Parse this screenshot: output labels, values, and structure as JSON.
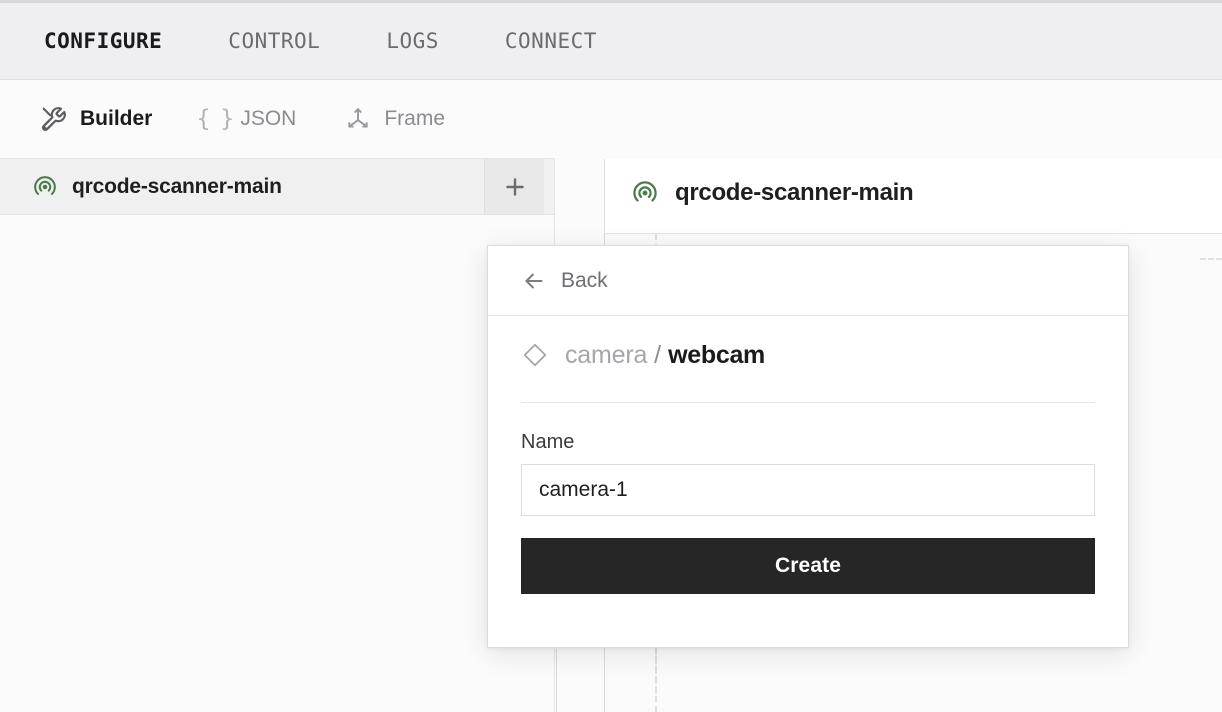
{
  "topnav": {
    "items": [
      {
        "label": "CONFIGURE",
        "active": true
      },
      {
        "label": "CONTROL",
        "active": false
      },
      {
        "label": "LOGS",
        "active": false
      },
      {
        "label": "CONNECT",
        "active": false
      }
    ]
  },
  "subtabs": {
    "items": [
      {
        "label": "Builder",
        "icon": "tools-icon",
        "active": true
      },
      {
        "label": "JSON",
        "icon": "braces-icon",
        "active": false
      },
      {
        "label": "Frame",
        "icon": "axes-icon",
        "active": false
      }
    ]
  },
  "sidebar": {
    "selected_item": {
      "label": "qrcode-scanner-main",
      "icon": "broadcast-icon"
    },
    "add_button": {
      "label": "+",
      "icon": "plus-icon"
    }
  },
  "canvas": {
    "node_card": {
      "label": "qrcode-scanner-main",
      "icon": "broadcast-icon"
    }
  },
  "modal": {
    "back": {
      "label": "Back",
      "icon": "arrow-left-icon"
    },
    "title": {
      "icon": "diamond-icon",
      "type": "camera",
      "separator": "/",
      "name": "webcam"
    },
    "name_field": {
      "label": "Name",
      "value": "camera-1",
      "placeholder": "camera-1"
    },
    "create_button": {
      "label": "Create"
    }
  },
  "colors": {
    "accent_green": "#4a7c4a",
    "button_dark": "#262626",
    "topbar_bg": "#efeff1",
    "canvas_bg": "#fbfbfb",
    "border": "#e2e2e3"
  }
}
